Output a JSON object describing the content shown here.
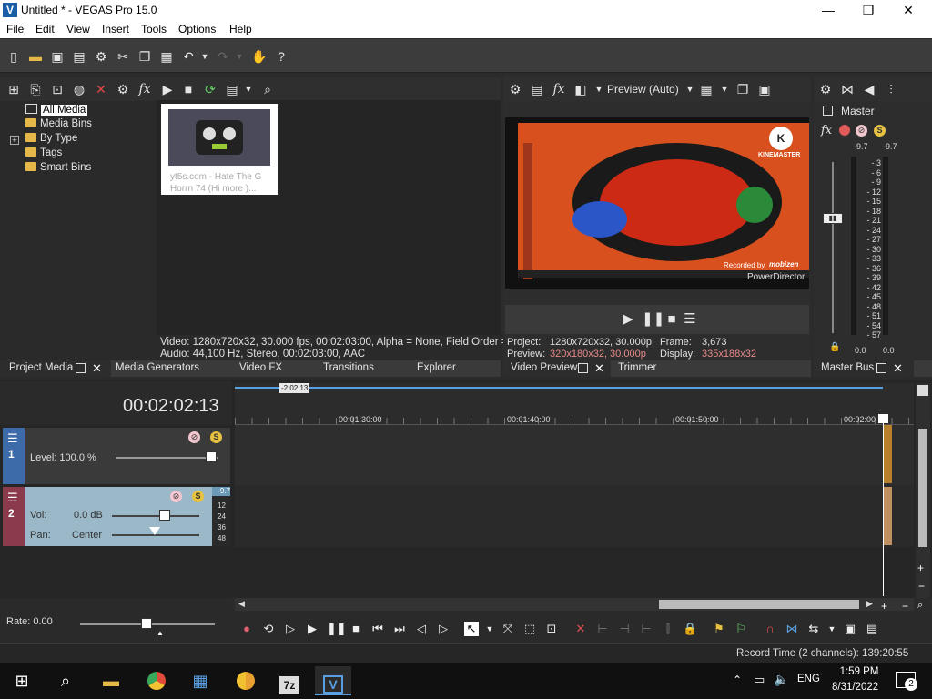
{
  "window": {
    "title": "Untitled * - VEGAS Pro 15.0",
    "logo": "V",
    "min": "—",
    "max": "❐",
    "close": "✕"
  },
  "menu": [
    "File",
    "Edit",
    "View",
    "Insert",
    "Tools",
    "Options",
    "Help"
  ],
  "project_media": {
    "tree": [
      "All Media",
      "Media Bins",
      "By Type",
      "Tags",
      "Smart Bins"
    ],
    "expand_glyph": "+",
    "thumbnail_caption": "yt5s.com - Hate The G Horrn 74 (Hi more )...",
    "video_info": "Video: 1280x720x32, 30.000 fps, 00:02:03:00, Alpha = None, Field Order =",
    "audio_info": "Audio: 44,100 Hz, Stereo, 00:02:03:00, AAC"
  },
  "left_tabs": [
    "Project Media",
    "Media Generators",
    "Video FX",
    "Transitions",
    "Explorer"
  ],
  "preview": {
    "mode": "Preview (Auto)",
    "kinemaster_label": "KINEMASTER",
    "kinemaster_logo": "K",
    "recorded_by": "Recorded by",
    "mobizen": "mobizen",
    "powerdirector": "PowerDirector",
    "project_label": "Project:",
    "project_value": "1280x720x32, 30.000p",
    "frame_label": "Frame:",
    "frame_value": "3,673",
    "preview_label": "Preview:",
    "preview_value": "320x180x32, 30.000p",
    "display_label": "Display:",
    "display_value": "335x188x32"
  },
  "preview_tabs": [
    "Video Preview",
    "Trimmer"
  ],
  "master_bus": {
    "label": "Master",
    "peak_left": "-9.7",
    "peak_right": "-9.7",
    "scale": [
      "3",
      "6",
      "9",
      "12",
      "15",
      "18",
      "21",
      "24",
      "27",
      "30",
      "33",
      "36",
      "39",
      "42",
      "45",
      "48",
      "51",
      "54",
      "57"
    ],
    "bottom_left": "0.0",
    "bottom_right": "0.0",
    "tab": "Master Bus"
  },
  "timeline": {
    "timecode": "00:02:02:13",
    "cursor_label": "-2:02:13",
    "ruler": [
      "00:01:30:00",
      "00:01:40:00",
      "00:01:50:00",
      "00:02:00"
    ],
    "track1": {
      "number": "1",
      "level_label": "Level: 100.0 %"
    },
    "track2": {
      "number": "2",
      "vol_label": "Vol:",
      "vol_value": "0.0 dB",
      "pan_label": "Pan:",
      "pan_value": "Center",
      "peak": "-9.7",
      "scale": [
        "12",
        "24",
        "36",
        "48"
      ]
    },
    "rate_label": "Rate: 0.00"
  },
  "status": {
    "record_time": "Record Time (2 channels): 139:20:55"
  },
  "taskbar": {
    "lang": "ENG",
    "time": "1:59 PM",
    "date": "8/31/2022",
    "notif_count": "2",
    "sevenzip": "7z"
  }
}
